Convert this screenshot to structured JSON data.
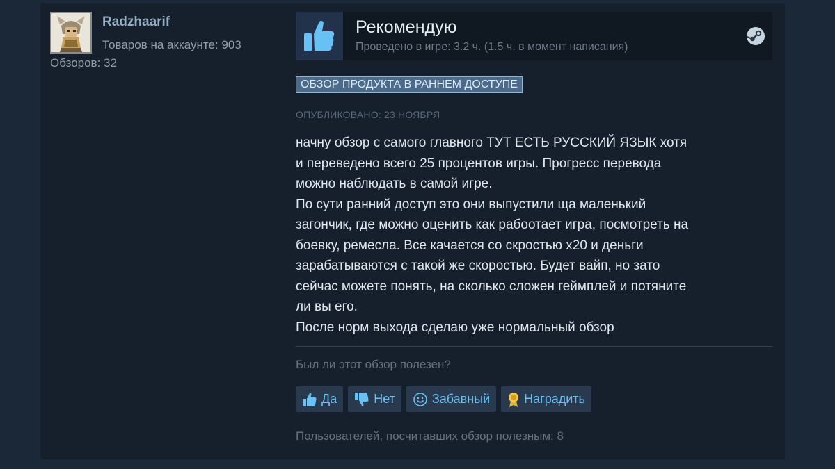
{
  "author": {
    "name": "Radzhaarif",
    "products": "Товаров на аккаунте: 903",
    "reviews": "Обзоров: 32"
  },
  "verdict": {
    "title": "Рекомендую",
    "hours": "Проведено в игре: 3.2 ч. (1.5 ч. в момент написания)",
    "icon": "thumbs-up-icon"
  },
  "review": {
    "badge": "ОБЗОР ПРОДУКТА В РАННЕМ ДОСТУПЕ",
    "posted": "ОПУБЛИКОВАНО: 23 НОЯБРЯ",
    "lines": [
      "начну обзор с самого главного ТУТ ЕСТЬ РУССКИЙ ЯЗЫК хотя",
      "и переведено всего 25 процентов игры. Прогресс перевода",
      "можно наблюдать в самой игре.",
      "По сути ранний доступ это они выпустили ща маленький",
      "загончик, где можно оценить как рабоотает игра, посмотреть на",
      "боевку, ремесла. Все качается со скростью х20 и деньги",
      "зарабатываются с такой же скоростью. Будет вайп, но зато",
      "сейчас можете понять, на сколько сложен геймплей и потяните",
      "ли вы его.",
      "После норм выхода сделаю уже нормальный обзор"
    ]
  },
  "feedback": {
    "question": "Был ли этот обзор полезен?",
    "yes": "Да",
    "no": "Нет",
    "funny": "Забавный",
    "award": "Наградить",
    "helpful_count": "Пользователей, посчитавших обзор полезным: 8"
  },
  "colors": {
    "background": "#1b2838",
    "panel": "#16202d",
    "accent": "#67c1f5",
    "thumb": "#67c1f5"
  }
}
